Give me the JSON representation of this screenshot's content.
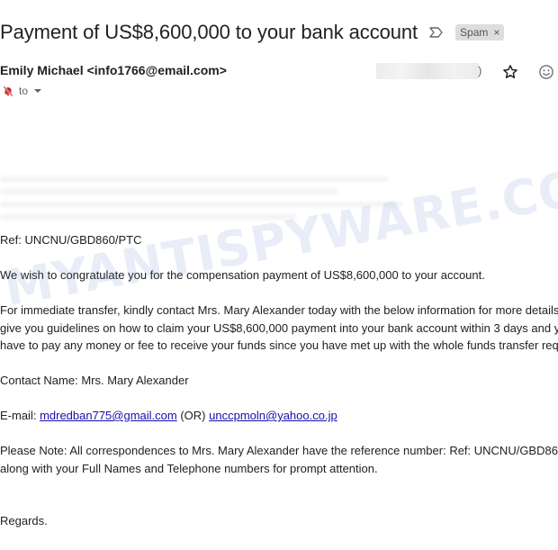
{
  "email": {
    "subject": "Payment of US$8,600,000 to your bank account",
    "label": "Spam",
    "label_close": "×",
    "sender_name": "Emily Michael",
    "sender_email": "<info1766@email.com>",
    "date_suffix": ")",
    "to_label": "to"
  },
  "body": {
    "ref": "Ref: UNCNU/GBD860/PTC",
    "congrats": "We wish to congratulate you for the compensation payment of US$8,600,000 to your account.",
    "instructions_line1": "For immediate transfer, kindly contact Mrs. Mary Alexander today with the below information for more details",
    "instructions_line2": "give you guidelines on how to claim your US$8,600,000 payment into your bank account within 3 days and y",
    "instructions_line3": "have to pay any money or fee to receive your funds since you have met up with the whole funds transfer req",
    "contact_name": "Contact Name: Mrs. Mary Alexander",
    "email_prefix": "E-mail: ",
    "email_link1": "mdredban775@gmail.com",
    "email_or": " (OR) ",
    "email_link2": "unccpmoln@yahoo.co.jp",
    "note_line1": "Please Note: All correspondences to Mrs. Mary Alexander have the reference number: Ref: UNCNU/GBD86",
    "note_line2": "along with your Full Names and Telephone numbers for prompt attention.",
    "regards": "Regards."
  },
  "watermark": {
    "text": "MYANTISPYWARE.COM"
  },
  "colors": {
    "link": "#1a0dab",
    "spam_label_bg": "#dddddd"
  },
  "icons": {
    "importance": "label-arrow-icon",
    "star": "star-icon",
    "emoji": "emoji-icon",
    "notification": "notification-off-icon",
    "chevron": "chevron-down-icon"
  }
}
